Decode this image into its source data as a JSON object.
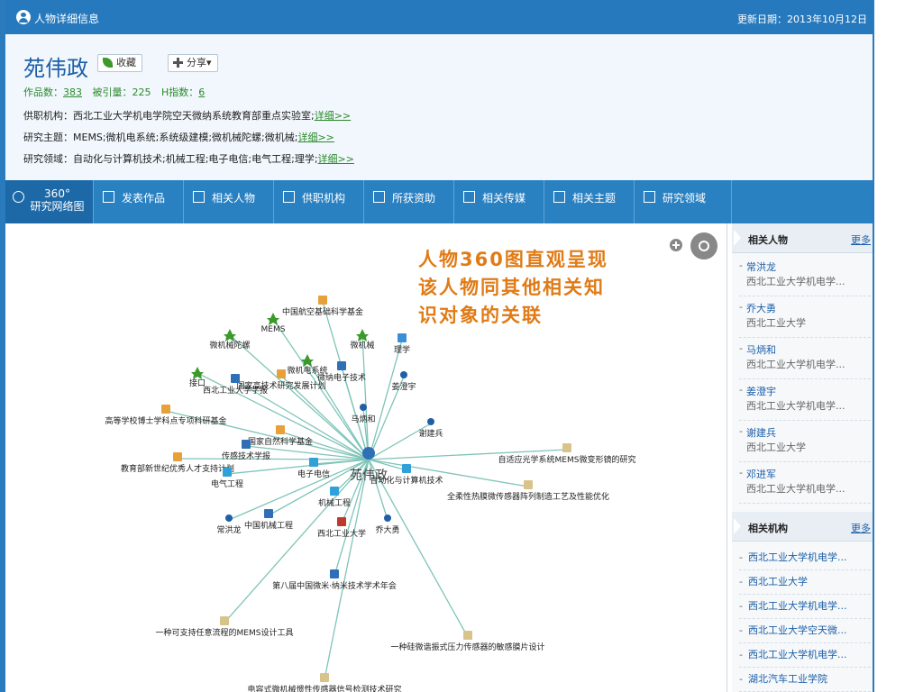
{
  "titlebar": {
    "title": "人物详细信息",
    "updated": "更新日期：2013年10月12日"
  },
  "person": {
    "name": "苑伟政",
    "collect_label": "收藏",
    "share_label": "分享▾",
    "works_label": "作品数：",
    "works": "383",
    "cited_label": "被引量：225",
    "h_label": "H指数：",
    "h": "6",
    "org_label": "供职机构：西北工业大学机电学院空天微纳系统教育部重点实验室;",
    "topic_label": "研究主题：MEMS;微机电系统;系统级建模;微机械陀螺;微机械;",
    "field_label": "研究领域：自动化与计算机技术;机械工程;电子电信;电气工程;理学;",
    "detail_link": "详细>>"
  },
  "tabs": [
    {
      "label": "360°",
      "sub": "研究网络图"
    },
    {
      "label": "发表作品"
    },
    {
      "label": "相关人物"
    },
    {
      "label": "供职机构"
    },
    {
      "label": "所获资助"
    },
    {
      "label": "相关传媒"
    },
    {
      "label": "相关主题"
    },
    {
      "label": "研究领域"
    }
  ],
  "callout": {
    "line1": "人物360图直观呈现",
    "line2": "该人物同其他相关知",
    "line3": "识对象的关联"
  },
  "graph": {
    "center": "苑伟政",
    "nodes": [
      {
        "label": "中国航空基础科学基金",
        "icon": "doc"
      },
      {
        "label": "MEMS",
        "icon": "star"
      },
      {
        "label": "微机械陀螺",
        "icon": "star"
      },
      {
        "label": "微机械",
        "icon": "star"
      },
      {
        "label": "理学",
        "icon": "drop"
      },
      {
        "label": "微机电系统",
        "icon": "star"
      },
      {
        "label": "微纳电子技术",
        "icon": "pc"
      },
      {
        "label": "姜澄宇",
        "icon": "person"
      },
      {
        "label": "接口",
        "icon": "star"
      },
      {
        "label": "国家高技术研究发展计划",
        "icon": "doc"
      },
      {
        "label": "西北工业大学学报",
        "icon": "pc"
      },
      {
        "label": "马炳和",
        "icon": "person"
      },
      {
        "label": "高等学校博士学科点专项科研基金",
        "icon": "doc"
      },
      {
        "label": "谢建兵",
        "icon": "person"
      },
      {
        "label": "国家自然科学基金",
        "icon": "doc"
      },
      {
        "label": "传感技术学报",
        "icon": "pc"
      },
      {
        "label": "教育部新世纪优秀人才支持计划",
        "icon": "doc"
      },
      {
        "label": "电气工程",
        "icon": "puzzle"
      },
      {
        "label": "电子电信",
        "icon": "puzzle"
      },
      {
        "label": "自适应光学系统MEMS微变形镜的研究",
        "icon": "book"
      },
      {
        "label": "自动化与计算机技术",
        "icon": "puzzle"
      },
      {
        "label": "机械工程",
        "icon": "puzzle"
      },
      {
        "label": "全柔性热膜微传感器阵列制造工艺及性能优化",
        "icon": "book"
      },
      {
        "label": "常洪龙",
        "icon": "person"
      },
      {
        "label": "中国机械工程",
        "icon": "pc"
      },
      {
        "label": "西北工业大学",
        "icon": "house"
      },
      {
        "label": "乔大勇",
        "icon": "person"
      },
      {
        "label": "第八届中国微米·纳米技术学术年会",
        "icon": "pc"
      },
      {
        "label": "一种可支持任意流程的MEMS设计工具",
        "icon": "book"
      },
      {
        "label": "一种硅微谐振式压力传感器的敏感膜片设计",
        "icon": "book"
      },
      {
        "label": "电容式微机械惯性传感器信号检测技术研究",
        "icon": "book"
      }
    ]
  },
  "side": {
    "people_title": "相关人物",
    "more": "更多",
    "people": [
      {
        "name": "常洪龙",
        "org": "西北工业大学机电学..."
      },
      {
        "name": "乔大勇",
        "org": "西北工业大学"
      },
      {
        "name": "马炳和",
        "org": "西北工业大学机电学..."
      },
      {
        "name": "姜澄宇",
        "org": "西北工业大学机电学..."
      },
      {
        "name": "谢建兵",
        "org": "西北工业大学"
      },
      {
        "name": "邓进军",
        "org": "西北工业大学机电学..."
      }
    ],
    "orgs_title": "相关机构",
    "orgs": [
      "西北工业大学机电学...",
      "西北工业大学",
      "西北工业大学机电学...",
      "西北工业大学空天微...",
      "西北工业大学机电学...",
      "湖北汽车工业学院"
    ]
  },
  "colors": {
    "brand": "#2679bd",
    "tab_bar": "#2a81c2",
    "callout_text": "#e07b16",
    "edge": "#7fc4b8",
    "link": "#1c5fa8"
  }
}
